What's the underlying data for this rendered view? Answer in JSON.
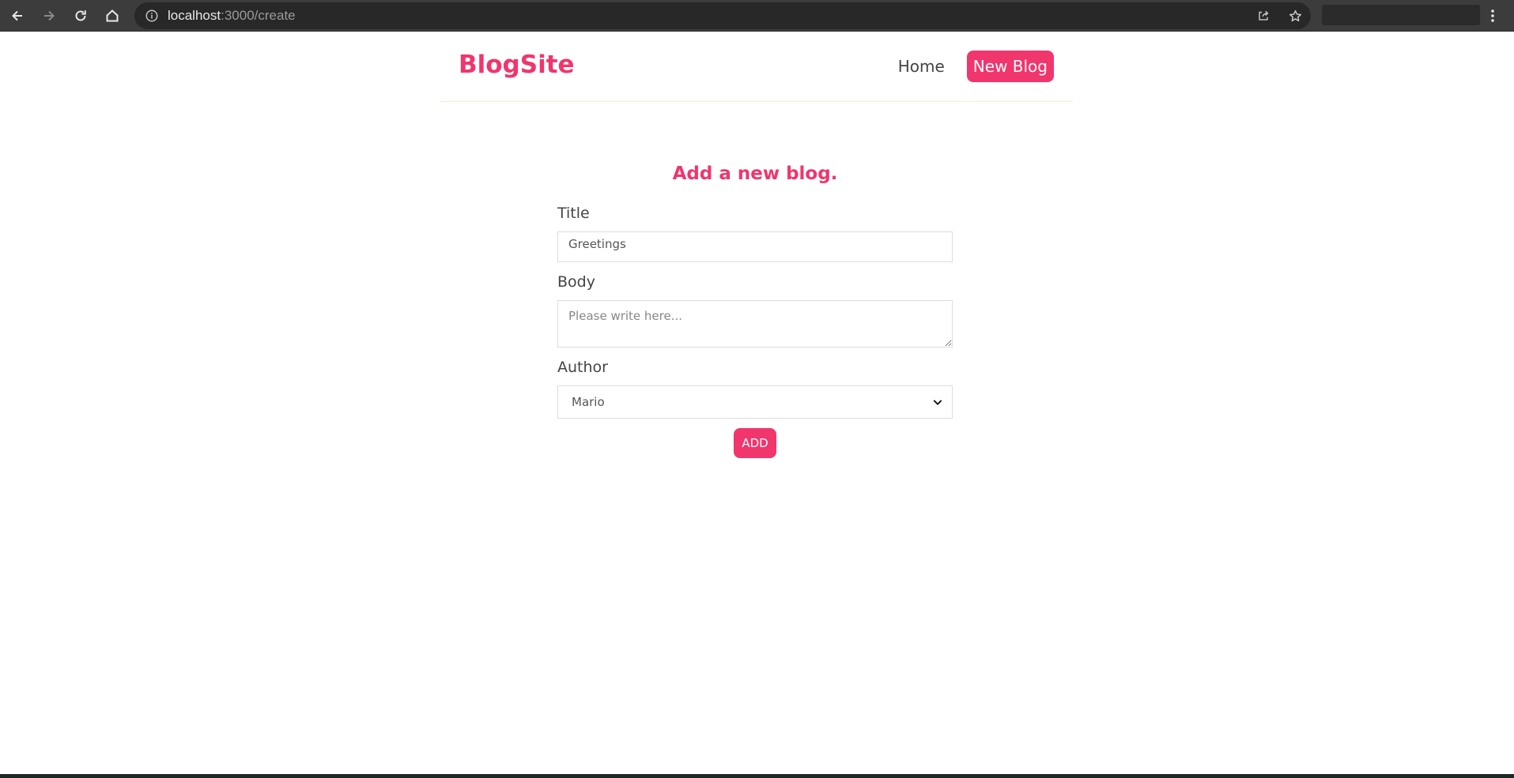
{
  "browser": {
    "url_host": "localhost",
    "url_path": ":3000/create",
    "icons": [
      "back-arrow-icon",
      "forward-arrow-icon",
      "reload-icon",
      "home-icon",
      "info-icon",
      "share-icon",
      "star-icon",
      "kebab-menu-icon"
    ]
  },
  "navbar": {
    "brand": "BlogSite",
    "links": [
      {
        "label": "Home"
      },
      {
        "label": "New Blog"
      }
    ]
  },
  "form": {
    "heading": "Add a new blog.",
    "title_label": "Title",
    "title_value": "Greetings",
    "body_label": "Body",
    "body_placeholder": "Please write here...",
    "author_label": "Author",
    "author_selected": "Mario",
    "submit_label": "ADD"
  },
  "colors": {
    "accent": "#f1356d",
    "text": "#444444",
    "browser_chrome": "#3c3c3c"
  }
}
